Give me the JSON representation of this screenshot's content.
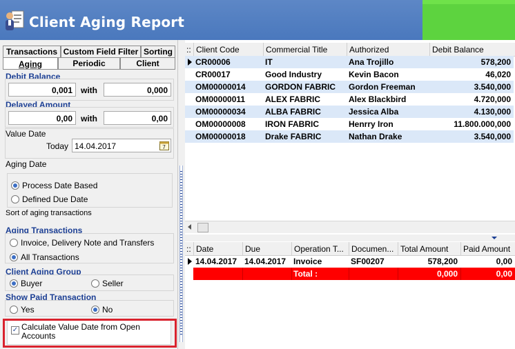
{
  "window": {
    "title": "Client Aging Report"
  },
  "tabs_top": [
    "Transactions",
    "Custom Field Filter",
    "Sorting"
  ],
  "tabs_bottom": [
    "Aging",
    "Periodic",
    "Client"
  ],
  "filters": {
    "debit_balance": {
      "label": "Debit Balance",
      "from": "0,001",
      "with": "with",
      "to": "0,000"
    },
    "delayed_amount": {
      "label": "Delayed Amount",
      "from": "0,00",
      "with": "with",
      "to": "0,00"
    },
    "value_date": {
      "label": "Value Date",
      "today_label": "Today",
      "date": "14.04.2017"
    },
    "aging_date": {
      "label": "Aging Date",
      "options": [
        "Process Date Based",
        "Defined Due Date"
      ],
      "selected": 0,
      "note": "Sort of aging transactions"
    },
    "aging_transactions": {
      "label": "Aging Transactions",
      "options": [
        "Invoice, Delivery Note and Transfers",
        "All Transactions"
      ],
      "selected": 1
    },
    "client_aging_group": {
      "label": "Client Aging Group",
      "options": [
        "Buyer",
        "Seller"
      ],
      "selected": 0
    },
    "show_paid": {
      "label": "Show Paid Transaction",
      "options": [
        "Yes",
        "No"
      ],
      "selected": 1
    },
    "calc_value_date": {
      "label_line1": "Calculate Value Date from Open",
      "label_line2": "Accounts",
      "checked": true
    }
  },
  "clients_grid": {
    "header_marker": "::",
    "columns": [
      "Client Code",
      "Commercial Title",
      "Authorized",
      "Debit Balance"
    ],
    "rows": [
      [
        "CR00006",
        "IT",
        "Ana Trojillo",
        "578,200"
      ],
      [
        "CR00017",
        "Good Industry",
        "Kevin Bacon",
        "46,020"
      ],
      [
        "OM00000014",
        "GORDON FABRIC",
        "Gordon Freeman",
        "3.540,000"
      ],
      [
        "OM00000011",
        "ALEX FABRIC",
        "Alex Blackbird",
        "4.720,000"
      ],
      [
        "OM00000034",
        "ALBA FABRIC",
        "Jessica Alba",
        "4.130,000"
      ],
      [
        "OM00000008",
        "IRON FABRIC",
        "Henrry Iron",
        "11.800.000,000"
      ],
      [
        "OM00000018",
        "Drake FABRIC",
        "Nathan Drake",
        "3.540,000"
      ]
    ]
  },
  "transactions_grid": {
    "header_marker": "::",
    "columns": [
      "Date",
      "Due",
      "Operation T...",
      "Documen...",
      "Total Amount",
      "Paid Amount"
    ],
    "rows": [
      [
        "14.04.2017",
        "14.04.2017",
        "Invoice",
        "SF00207",
        "578,200",
        "0,00"
      ]
    ],
    "total": {
      "label": "Total :",
      "total_amount": "0,000",
      "paid_amount": "0,00"
    }
  },
  "colors": {
    "title_bar": "#4a78bd",
    "accent_text": "#1c3f94",
    "row_alt": "#dbe8f8",
    "total_row": "#ff0000",
    "highlight_frame": "#d9232e"
  }
}
